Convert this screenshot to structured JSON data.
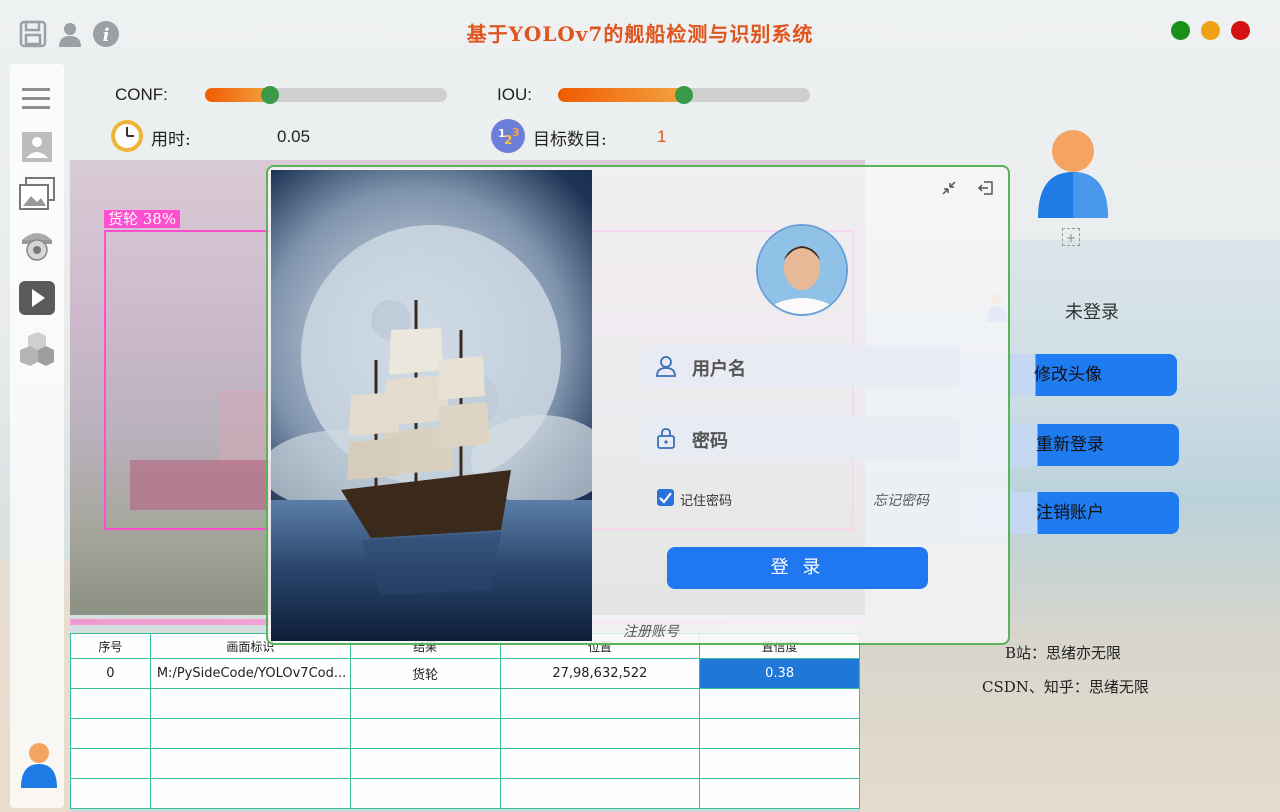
{
  "app": {
    "title": "基于YOLOv7的舰船检测与识别系统",
    "window_buttons": [
      "#1a8f1a",
      "#f0a215",
      "#d41212"
    ]
  },
  "toolbar_top": {
    "icons": [
      "save-icon",
      "user-icon",
      "info-icon"
    ]
  },
  "sidebar": {
    "items": [
      "menu-icon",
      "image-icon",
      "images-folder-icon",
      "camera-icon",
      "video-icon",
      "model-cube-icon",
      "user-avatar-icon"
    ]
  },
  "params": {
    "conf_label": "CONF:",
    "conf_value": 0.27,
    "iou_label": "IOU:",
    "iou_value": 0.5,
    "time_label": "用时:",
    "time_value": "0.05",
    "count_label": "目标数目:",
    "count_value": "1"
  },
  "detection": {
    "box_label": "货轮  38%"
  },
  "table": {
    "headers": [
      "序号",
      "画面标识",
      "结果",
      "位置",
      "置信度"
    ],
    "rows": [
      [
        "0",
        "M:/PySideCode/YOLOv7Cod...",
        "货轮",
        "27,98,632,522",
        "0.38"
      ],
      [
        "",
        "",
        "",
        "",
        ""
      ],
      [
        "",
        "",
        "",
        "",
        ""
      ],
      [
        "",
        "",
        "",
        "",
        ""
      ],
      [
        "",
        "",
        "",
        "",
        ""
      ]
    ]
  },
  "right_panel": {
    "status": "未登录",
    "btn_change_avatar": "修改头像",
    "btn_relogin": "重新登录",
    "btn_cancel_account": "注销账户",
    "credit1": "B站：思绪亦无限",
    "credit2": "CSDN、知乎：思绪无限"
  },
  "login": {
    "username_placeholder": "用户名",
    "password_placeholder": "密码",
    "remember_label": "记住密码",
    "remember_checked": true,
    "forgot_label": "忘记密码",
    "login_button": "登 录",
    "register_label": "注册账号"
  }
}
